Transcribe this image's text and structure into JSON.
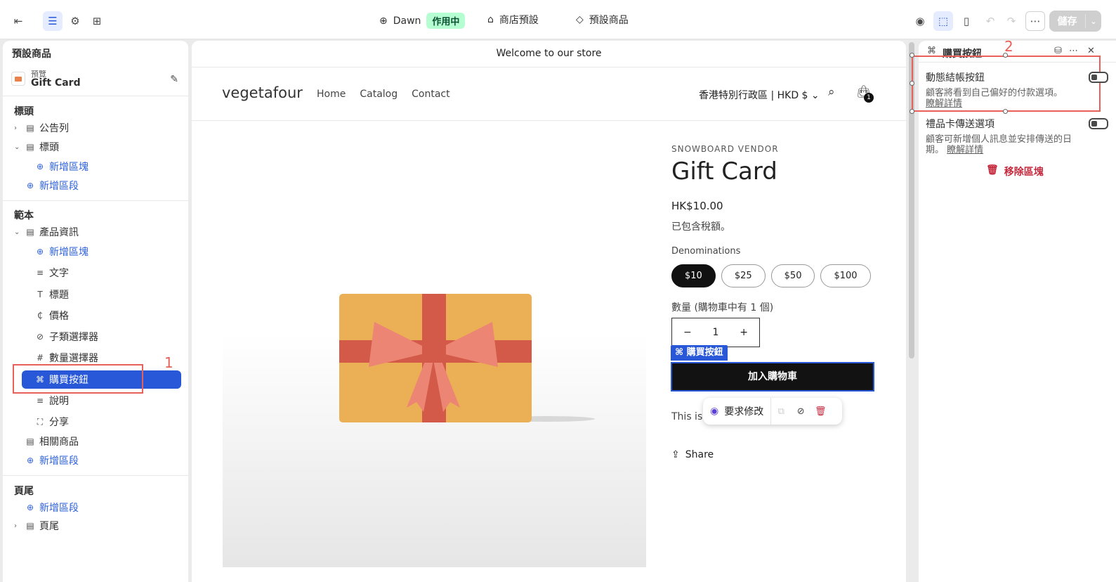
{
  "topbar": {
    "theme_name": "Dawn",
    "theme_status": "作用中",
    "store_preset": "商店預設",
    "preset_product": "預設商品",
    "save_label": "儲存"
  },
  "left_panel": {
    "title": "預設商品",
    "preview_sub": "預覽",
    "preview_name": "Gift Card",
    "header_group": {
      "heading": "標頭",
      "items": [
        {
          "label": "公告列"
        },
        {
          "label": "標頭"
        },
        {
          "label": "新增區塊"
        },
        {
          "label": "新增區段"
        }
      ]
    },
    "template_group": {
      "heading": "範本",
      "items": [
        {
          "label": "產品資訊"
        },
        {
          "label": "新增區塊"
        },
        {
          "label": "文字"
        },
        {
          "label": "標題"
        },
        {
          "label": "價格"
        },
        {
          "label": "子類選擇器"
        },
        {
          "label": "數量選擇器"
        },
        {
          "label": "購買按鈕"
        },
        {
          "label": "說明"
        },
        {
          "label": "分享"
        },
        {
          "label": "相關商品"
        },
        {
          "label": "新增區段"
        }
      ]
    },
    "footer_group": {
      "heading": "頁尾",
      "items": [
        {
          "label": "新增區段"
        },
        {
          "label": "頁尾"
        }
      ]
    },
    "annotation_number": "1"
  },
  "store": {
    "announcement": "Welcome to our store",
    "logo": "vegetafour",
    "nav": [
      "Home",
      "Catalog",
      "Contact"
    ],
    "region": "香港特別行政區 | HKD $",
    "cart_count": "1",
    "vendor": "SNOWBOARD VENDOR",
    "title": "Gift Card",
    "price": "HK$10.00",
    "tax_note": "已包含稅額。",
    "denominations_label": "Denominations",
    "denominations": [
      "$10",
      "$25",
      "$50",
      "$100"
    ],
    "quantity_label": "數量 (購物車中有 1 個)",
    "quantity_minus": "−",
    "quantity_value": "1",
    "quantity_plus": "+",
    "block_tag": "購買按鈕",
    "add_to_cart": "加入購物車",
    "description_text": "This is a",
    "request_change": "要求修改",
    "share": "Share"
  },
  "right_panel": {
    "title": "購買按鈕",
    "annotation_number": "2",
    "settings": [
      {
        "name": "動態結帳按鈕",
        "desc": "顧客將看到自己偏好的付款選項。",
        "link": "瞭解詳情",
        "enabled": false
      },
      {
        "name": "禮品卡傳送選項",
        "desc": "顧客可新增個人訊息並安排傳送的日期。",
        "link": "瞭解詳情",
        "enabled": false
      }
    ],
    "remove_label": "移除區塊"
  },
  "colors": {
    "accent": "#2858d8",
    "annotation": "#e8605a",
    "danger": "#c5283d",
    "gift_box": "#ebb055",
    "gift_ribbon": "#d35a48",
    "gift_bow": "#ec8574"
  }
}
